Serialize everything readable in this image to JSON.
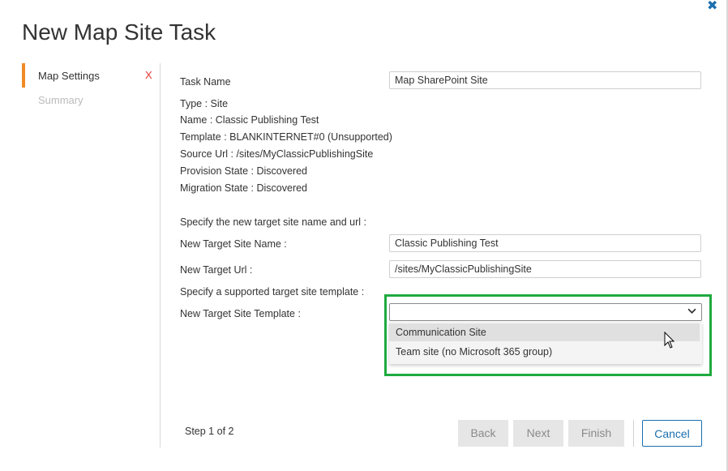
{
  "dialog": {
    "title": "New Map Site Task",
    "close_icon": "close-icon"
  },
  "nav": {
    "items": [
      {
        "label": "Map Settings",
        "active": true,
        "status": "X"
      },
      {
        "label": "Summary",
        "active": false
      }
    ],
    "accent": "#f08a24"
  },
  "form": {
    "task_name_label": "Task Name",
    "task_name_value": "Map SharePoint Site",
    "info": [
      "Type : Site",
      "Name : Classic Publishing Test",
      "Template : BLANKINTERNET#0 (Unsupported)",
      "Source Url : /sites/MyClassicPublishingSite",
      "Provision State : Discovered",
      "Migration State : Discovered"
    ],
    "target_heading": "Specify the new target site name and url :",
    "target_name_label": "New Target Site Name :",
    "target_name_value": "Classic Publishing Test",
    "target_url_label": "New Target Url :",
    "target_url_value": "/sites/MyClassicPublishingSite",
    "template_heading": "Specify a supported target site template :",
    "template_label": "New Target Site Template :",
    "template_value": "",
    "template_options": [
      "Communication Site",
      "Team site (no Microsoft 365 group)"
    ],
    "highlight_color": "#1faa3f"
  },
  "footer": {
    "step": "Step 1 of 2",
    "back": "Back",
    "next": "Next",
    "finish": "Finish",
    "cancel": "Cancel"
  }
}
